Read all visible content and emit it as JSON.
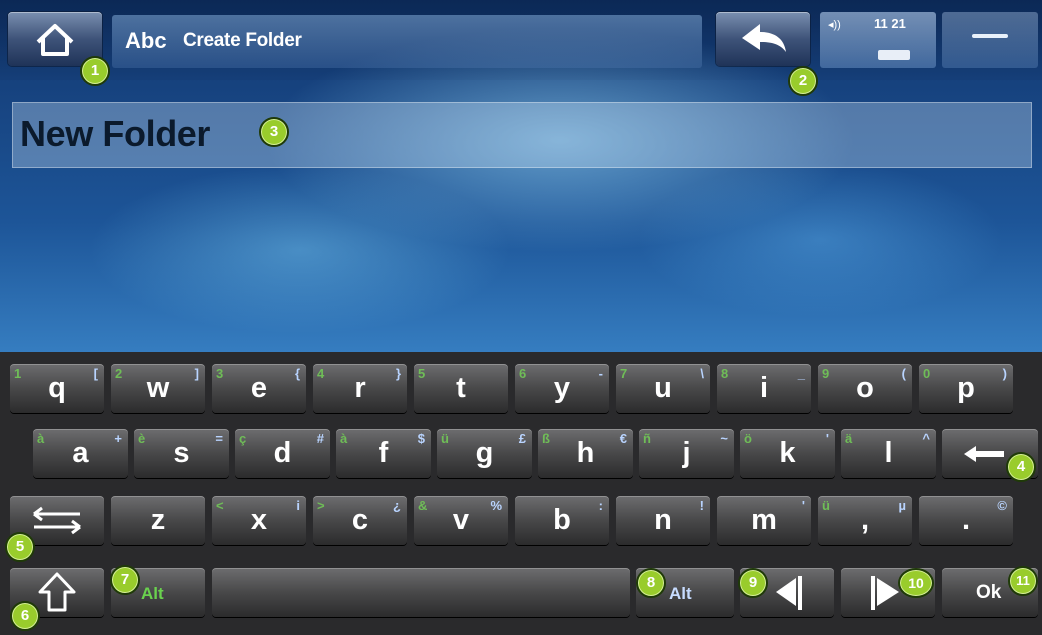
{
  "header": {
    "title_icon": "Abc",
    "title": "Create Folder",
    "volume": "◂))",
    "time": "11 21"
  },
  "textfield": {
    "value": "New Folder"
  },
  "keyboard": {
    "row1": [
      {
        "main": "q",
        "sec": "1",
        "alt": "["
      },
      {
        "main": "w",
        "sec": "2",
        "alt": "]"
      },
      {
        "main": "e",
        "sec": "3",
        "alt": "{"
      },
      {
        "main": "r",
        "sec": "4",
        "alt": "}"
      },
      {
        "main": "t",
        "sec": "5",
        "alt": ""
      },
      {
        "main": "y",
        "sec": "6",
        "alt": "-"
      },
      {
        "main": "u",
        "sec": "7",
        "alt": "\\"
      },
      {
        "main": "i",
        "sec": "8",
        "alt": "_"
      },
      {
        "main": "o",
        "sec": "9",
        "alt": "("
      },
      {
        "main": "p",
        "sec": "0",
        "alt": ")"
      }
    ],
    "row2": [
      {
        "main": "a",
        "sec": "à",
        "alt": "+"
      },
      {
        "main": "s",
        "sec": "è",
        "alt": "="
      },
      {
        "main": "d",
        "sec": "ç",
        "alt": "#"
      },
      {
        "main": "f",
        "sec": "à",
        "alt": "$"
      },
      {
        "main": "g",
        "sec": "ü",
        "alt": "£"
      },
      {
        "main": "h",
        "sec": "ß",
        "alt": "€"
      },
      {
        "main": "j",
        "sec": "ñ",
        "alt": "~"
      },
      {
        "main": "k",
        "sec": "ö",
        "alt": "'"
      },
      {
        "main": "l",
        "sec": "ä",
        "alt": "^"
      }
    ],
    "row3": [
      {
        "main": "z",
        "sec": "",
        "alt": ""
      },
      {
        "main": "x",
        "sec": "<",
        "alt": "i"
      },
      {
        "main": "c",
        "sec": ">",
        "alt": "¿"
      },
      {
        "main": "v",
        "sec": "&",
        "alt": "%"
      },
      {
        "main": "b",
        "sec": "",
        "alt": ":"
      },
      {
        "main": "n",
        "sec": "",
        "alt": "!"
      },
      {
        "main": "m",
        "sec": "",
        "alt": "'"
      },
      {
        "main": ",",
        "sec": "ü",
        "alt": "µ"
      },
      {
        "main": ".",
        "sec": "",
        "alt": "©"
      }
    ],
    "alt_left": "Alt",
    "alt_right": "Alt",
    "ok": "Ok"
  },
  "callouts": [
    "1",
    "2",
    "3",
    "4",
    "5",
    "6",
    "7",
    "8",
    "9",
    "10",
    "11"
  ]
}
